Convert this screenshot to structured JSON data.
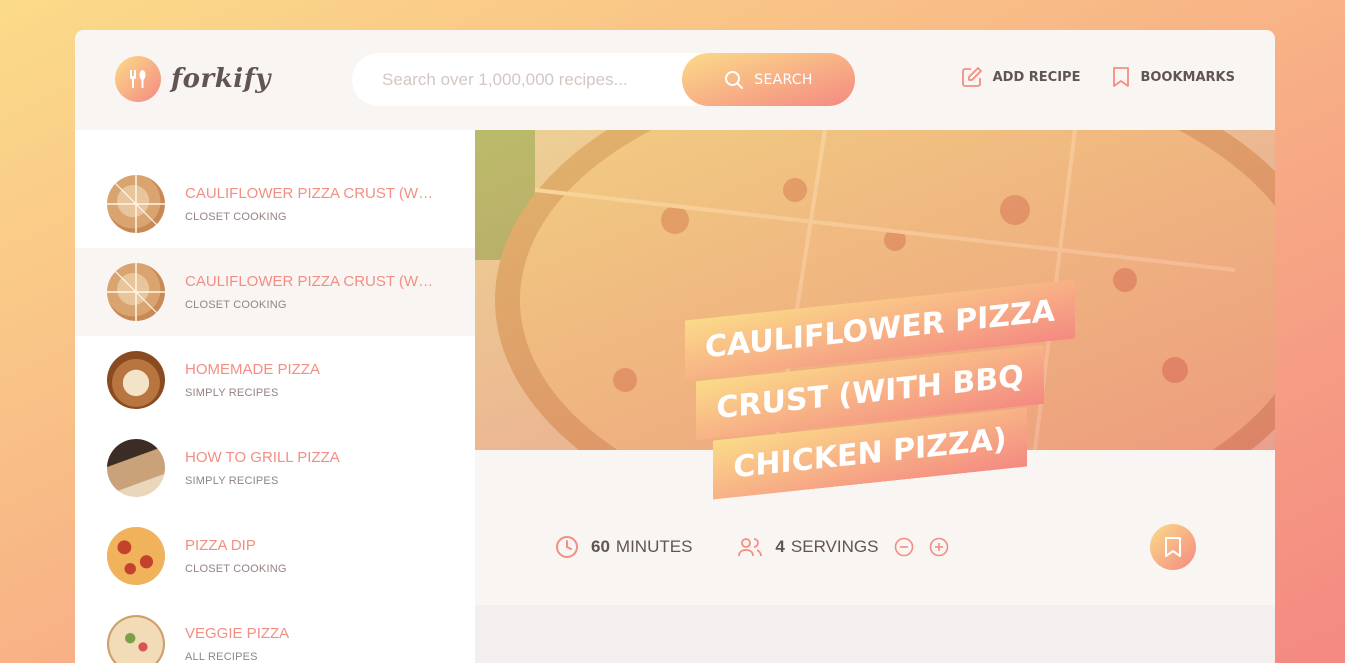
{
  "header": {
    "logo_text": "forkify",
    "search_placeholder": "Search over 1,000,000 recipes...",
    "search_button": "Search",
    "nav": [
      {
        "label": "Add recipe",
        "icon": "edit-icon"
      },
      {
        "label": "Bookmarks",
        "icon": "bookmark-icon"
      }
    ]
  },
  "results": [
    {
      "title": "Cauliflower Pizza Crust (with BBQ Chicken Pizza)",
      "publisher": "Closet Cooking",
      "active": false
    },
    {
      "title": "Cauliflower Pizza Crust (with BBQ Chicken Pizza)",
      "publisher": "Closet Cooking",
      "active": true
    },
    {
      "title": "Homemade Pizza",
      "publisher": "Simply Recipes",
      "active": false
    },
    {
      "title": "How to Grill Pizza",
      "publisher": "Simply Recipes",
      "active": false
    },
    {
      "title": "Pizza Dip",
      "publisher": "Closet Cooking",
      "active": false
    },
    {
      "title": "Veggie Pizza",
      "publisher": "All Recipes",
      "active": false
    }
  ],
  "recipe": {
    "title": "Cauliflower Pizza Crust (with BBQ Chicken Pizza)",
    "cooking_time": "60",
    "cooking_time_unit": "minutes",
    "servings": "4",
    "servings_unit": "servings"
  },
  "colors": {
    "accent_from": "#fbdb89",
    "accent_to": "#f48982",
    "text": "#615551"
  }
}
